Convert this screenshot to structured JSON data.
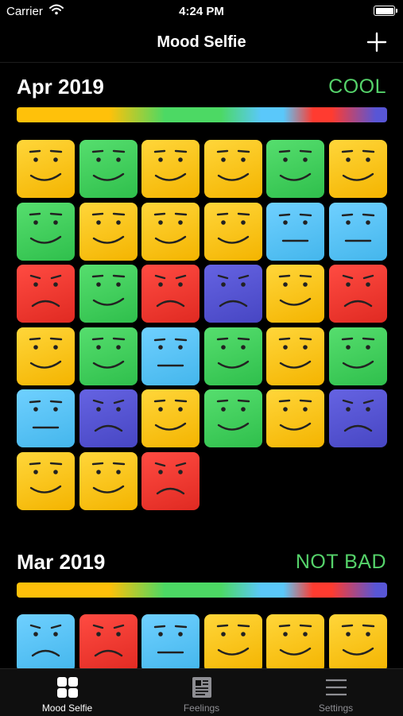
{
  "status_bar": {
    "carrier": "Carrier",
    "time": "4:24 PM"
  },
  "nav": {
    "title": "Mood Selfie",
    "add_icon": "plus-icon"
  },
  "colors": {
    "yellow": "#f9c612",
    "green": "#45d15d",
    "blue": "#5ac3f5",
    "red": "#f0362e",
    "purple": "#5654d4",
    "rating_text": "#55d26a"
  },
  "months": [
    {
      "title": "Apr 2019",
      "rating": "COOL",
      "faces": [
        {
          "color": "yellow",
          "mood": "happy"
        },
        {
          "color": "green",
          "mood": "happy"
        },
        {
          "color": "yellow",
          "mood": "happy"
        },
        {
          "color": "yellow",
          "mood": "happy"
        },
        {
          "color": "green",
          "mood": "happy"
        },
        {
          "color": "yellow",
          "mood": "happy"
        },
        {
          "color": "green",
          "mood": "happy"
        },
        {
          "color": "yellow",
          "mood": "happy"
        },
        {
          "color": "yellow",
          "mood": "happy"
        },
        {
          "color": "yellow",
          "mood": "happy"
        },
        {
          "color": "blue",
          "mood": "neutral"
        },
        {
          "color": "blue",
          "mood": "neutral"
        },
        {
          "color": "red",
          "mood": "sad"
        },
        {
          "color": "green",
          "mood": "happy"
        },
        {
          "color": "red",
          "mood": "sad"
        },
        {
          "color": "purple",
          "mood": "sad"
        },
        {
          "color": "yellow",
          "mood": "happy"
        },
        {
          "color": "red",
          "mood": "sad"
        },
        {
          "color": "yellow",
          "mood": "happy"
        },
        {
          "color": "green",
          "mood": "happy"
        },
        {
          "color": "blue",
          "mood": "neutral"
        },
        {
          "color": "green",
          "mood": "happy"
        },
        {
          "color": "yellow",
          "mood": "happy"
        },
        {
          "color": "green",
          "mood": "happy"
        },
        {
          "color": "blue",
          "mood": "neutral"
        },
        {
          "color": "purple",
          "mood": "sad"
        },
        {
          "color": "yellow",
          "mood": "happy"
        },
        {
          "color": "green",
          "mood": "happy"
        },
        {
          "color": "yellow",
          "mood": "happy"
        },
        {
          "color": "purple",
          "mood": "sad"
        },
        {
          "color": "yellow",
          "mood": "happy"
        },
        {
          "color": "yellow",
          "mood": "happy"
        },
        {
          "color": "red",
          "mood": "sad"
        }
      ]
    },
    {
      "title": "Mar 2019",
      "rating": "NOT BAD",
      "faces": [
        {
          "color": "blue",
          "mood": "sad"
        },
        {
          "color": "red",
          "mood": "sad"
        },
        {
          "color": "blue",
          "mood": "neutral"
        },
        {
          "color": "yellow",
          "mood": "happy"
        },
        {
          "color": "yellow",
          "mood": "happy"
        },
        {
          "color": "yellow",
          "mood": "happy"
        }
      ]
    }
  ],
  "tabs": [
    {
      "label": "Mood Selfie",
      "icon": "grid-icon",
      "active": true
    },
    {
      "label": "Feelings",
      "icon": "journal-icon",
      "active": false
    },
    {
      "label": "Settings",
      "icon": "hamburger-menu-icon",
      "active": false
    }
  ]
}
